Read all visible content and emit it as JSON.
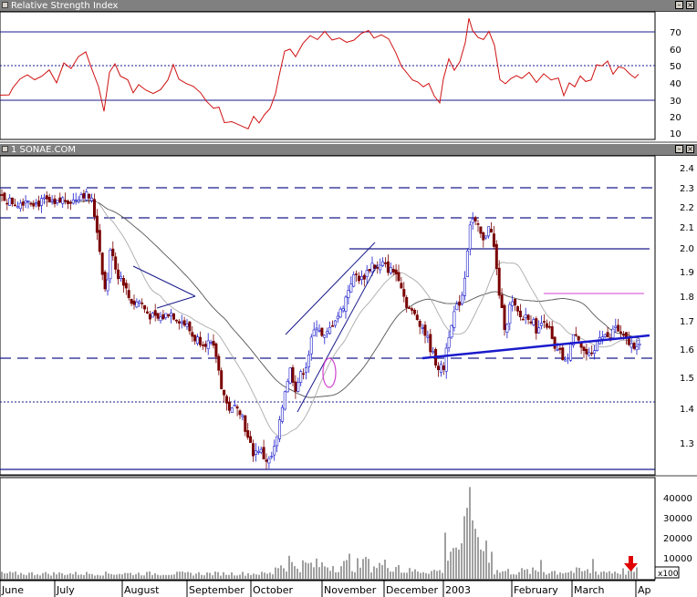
{
  "rsi_panel": {
    "title": "Relative Strength Index",
    "ticks": [
      "70",
      "60",
      "50",
      "40",
      "30",
      "20",
      "10"
    ]
  },
  "price_panel": {
    "title": "1 SONAE.COM",
    "ticks": [
      "2.4",
      "2.3",
      "2.2",
      "2.1",
      "2.0",
      "1.9",
      "1.8",
      "1.7",
      "1.6",
      "1.5",
      "1.4",
      "1.3"
    ]
  },
  "volume_panel": {
    "ticks": [
      "40000",
      "30000",
      "20000",
      "10000"
    ],
    "multiplier": "x100"
  },
  "months": [
    "June",
    "July",
    "August",
    "September",
    "October",
    "November",
    "December",
    "2003",
    "February",
    "March",
    "Ap"
  ],
  "colors": {
    "panel_header": "#808080",
    "candle_up": "#1a1acc",
    "candle_down": "#7a0000",
    "rsi_line": "#d01010",
    "reference_lines": "#1a1a8c",
    "highlight": "#d040d0",
    "arrow": "#e00000"
  },
  "chart_data": [
    {
      "type": "line",
      "name": "Relative Strength Index",
      "x": [
        "Jun",
        "Jul",
        "Aug",
        "Sep",
        "Oct",
        "Nov",
        "Dec",
        "2003",
        "Feb",
        "Mar",
        "Apr"
      ],
      "values": [
        32,
        52,
        38,
        20,
        18,
        66,
        70,
        44,
        72,
        44,
        47
      ],
      "reference_lines": [
        70,
        50,
        30
      ],
      "ylim": [
        5,
        80
      ]
    },
    {
      "type": "candlestick",
      "name": "SONAE.COM",
      "x": [
        "Jun",
        "Jul",
        "Aug",
        "Sep",
        "Oct",
        "Nov",
        "Dec",
        "2003",
        "Feb",
        "Mar",
        "Apr"
      ],
      "close": [
        2.23,
        2.26,
        1.82,
        1.55,
        1.28,
        1.93,
        1.62,
        2.12,
        1.74,
        1.72,
        1.69
      ],
      "ylim": [
        1.2,
        2.45
      ],
      "horizontal_levels": [
        2.29,
        2.15,
        2.0,
        1.57,
        1.43,
        1.22
      ],
      "moving_averages": 2
    },
    {
      "type": "bar",
      "name": "Volume",
      "x": [
        "Jun",
        "Jul",
        "Aug",
        "Sep",
        "Oct",
        "Nov",
        "Dec",
        "2003",
        "Feb",
        "Mar",
        "Apr"
      ],
      "values": [
        2000,
        3000,
        2000,
        1500,
        4000,
        8000,
        4500,
        44000,
        4500,
        3500,
        1500
      ],
      "ylim": [
        0,
        45000
      ]
    }
  ]
}
